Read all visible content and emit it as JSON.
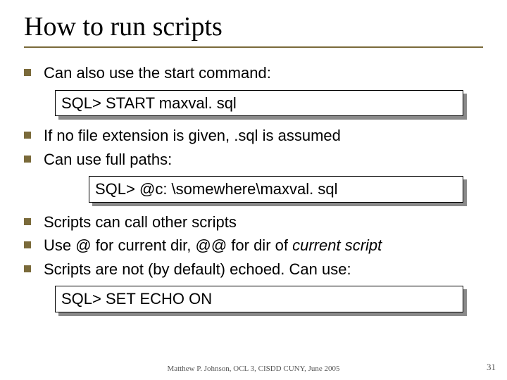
{
  "title": "How to run scripts",
  "bullets": {
    "b1": "Can also use the start command:",
    "b2": "If no file extension is given, .sql is assumed",
    "b3": "Can use full paths:",
    "b4": "Scripts can call other scripts",
    "b5_pre": "Use @ for current dir, @@ for dir of ",
    "b5_em": "current script",
    "b6": "Scripts are not (by default) echoed. Can use:"
  },
  "code": {
    "c1": "SQL> START maxval. sql",
    "c2": "SQL> @c: \\somewhere\\maxval. sql",
    "c3": "SQL> SET ECHO ON"
  },
  "footer": "Matthew P. Johnson, OCL 3, CISDD CUNY, June 2005",
  "page": "31"
}
